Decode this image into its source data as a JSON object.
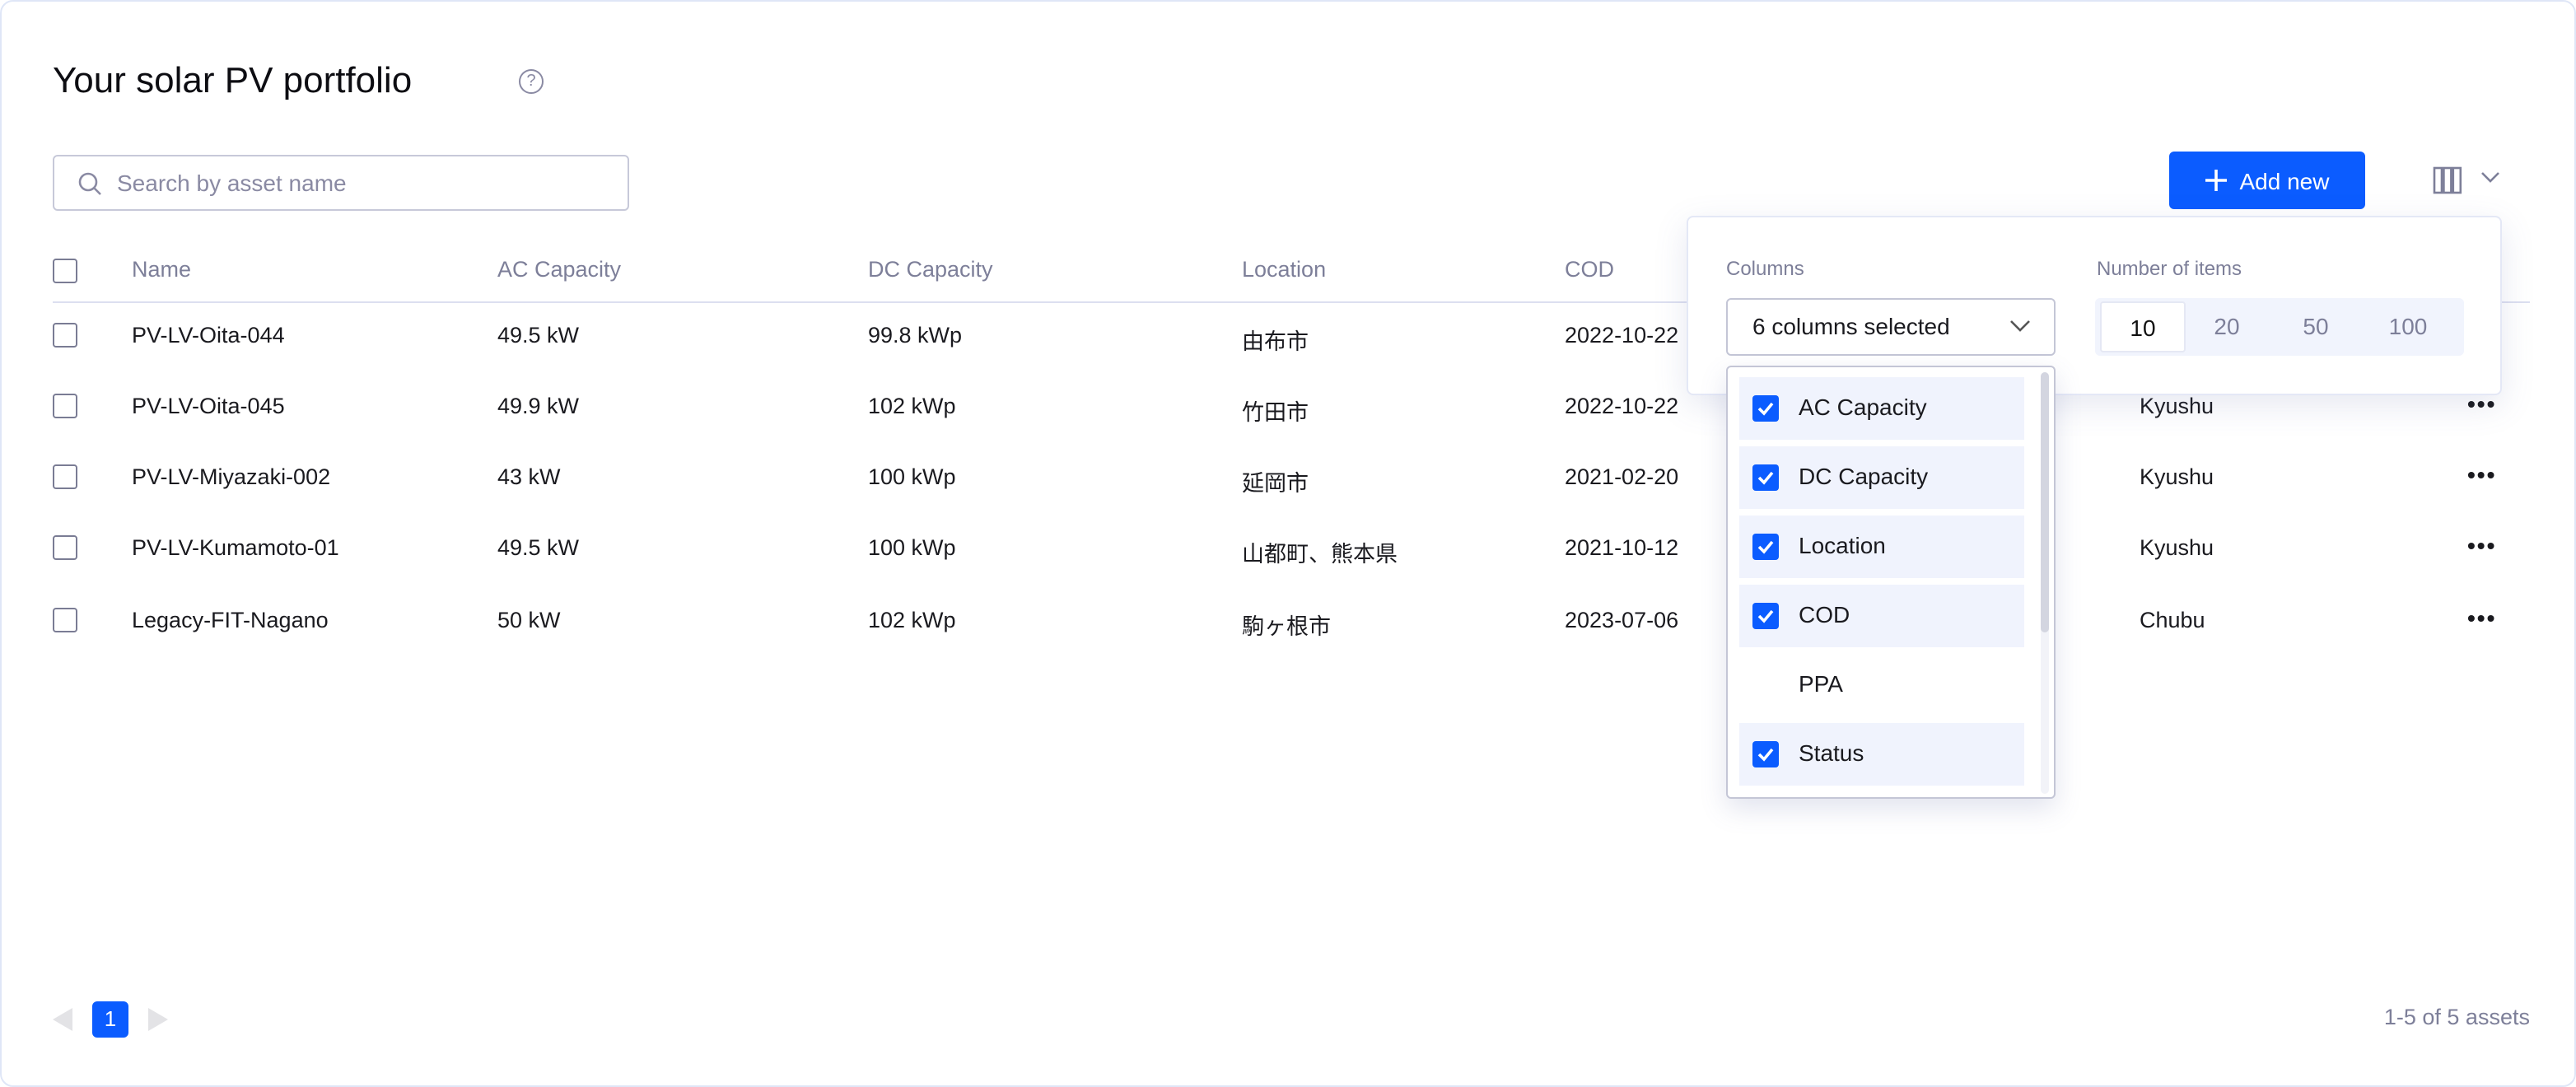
{
  "page": {
    "title": "Your solar PV portfolio",
    "help_icon": "question-circle-icon"
  },
  "search": {
    "placeholder": "Search by asset name",
    "value": ""
  },
  "toolbar": {
    "add_label": "Add new",
    "add_icon": "plus-icon",
    "columns_icon": "columns-icon"
  },
  "table": {
    "headers": [
      "Name",
      "AC Capacity",
      "DC Capacity",
      "Location",
      "COD"
    ],
    "rows": [
      {
        "name": "PV-LV-Oita-044",
        "ac": "49.5 kW",
        "dc": "99.8 kWp",
        "location": "由布市",
        "cod": "2022-10-22",
        "region": ""
      },
      {
        "name": "PV-LV-Oita-045",
        "ac": "49.9 kW",
        "dc": "102 kWp",
        "location": "竹田市",
        "cod": "2022-10-22",
        "region": "Kyushu"
      },
      {
        "name": "PV-LV-Miyazaki-002",
        "ac": "43 kW",
        "dc": "100 kWp",
        "location": "延岡市",
        "cod": "2021-02-20",
        "region": "Kyushu"
      },
      {
        "name": "PV-LV-Kumamoto-01",
        "ac": "49.5 kW",
        "dc": "100 kWp",
        "location": "山都町、熊本県",
        "cod": "2021-10-12",
        "region": "Kyushu"
      },
      {
        "name": "Legacy-FIT-Nagano",
        "ac": "50 kW",
        "dc": "102 kWp",
        "location": "駒ヶ根市",
        "cod": "2023-07-06",
        "region": "Chubu"
      }
    ],
    "row_menu": "•••"
  },
  "settings": {
    "columns_label": "Columns",
    "columns_value": "6 columns selected",
    "items_label": "Number of items",
    "items_options": [
      "10",
      "20",
      "50",
      "100"
    ],
    "items_selected": "10",
    "column_options": [
      {
        "label": "AC Capacity",
        "checked": true
      },
      {
        "label": "DC Capacity",
        "checked": true
      },
      {
        "label": "Location",
        "checked": true
      },
      {
        "label": "COD",
        "checked": true
      },
      {
        "label": "PPA",
        "checked": false
      },
      {
        "label": "Status",
        "checked": true
      }
    ]
  },
  "pagination": {
    "current": "1",
    "summary": "1-5 of 5 assets"
  },
  "colors": {
    "accent": "#0b5cff",
    "muted_text": "#7d7f99"
  }
}
